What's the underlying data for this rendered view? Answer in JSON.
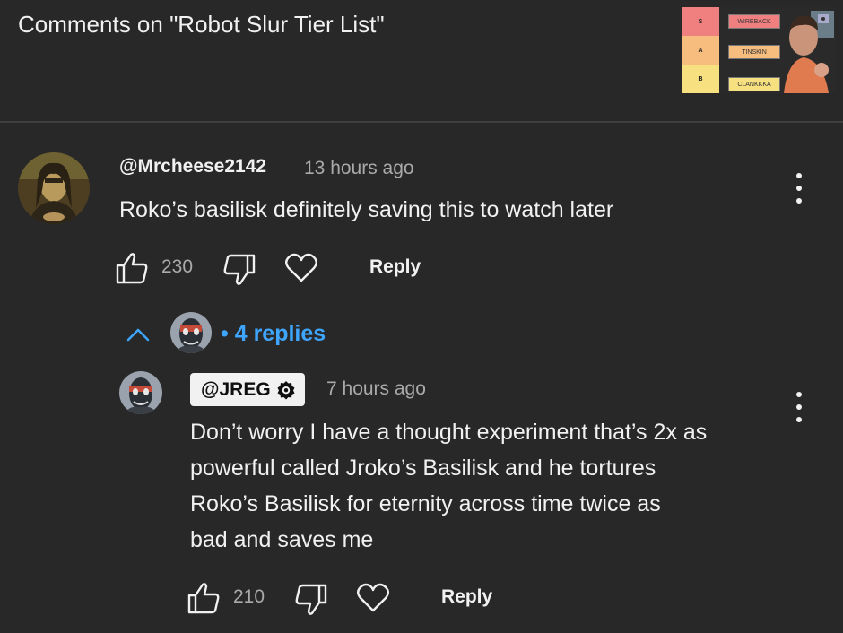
{
  "header": {
    "title": "Comments on \"Robot Slur Tier List\""
  },
  "thumbnail": {
    "tiers": [
      {
        "label": "S",
        "color": "#f08080",
        "card": "WIREBACK"
      },
      {
        "label": "A",
        "color": "#f6bd7f",
        "card": "TINSKIN"
      },
      {
        "label": "B",
        "color": "#f6e07f",
        "card": "CLANKKKA"
      }
    ]
  },
  "comment": {
    "author": "@Mrcheese2142",
    "time": "13 hours ago",
    "text": "Roko’s basilisk definitely saving this to watch later",
    "likes": "230",
    "reply_label": "Reply"
  },
  "replies_toggle": {
    "label": "4 replies",
    "bullet": "•",
    "color": "#3ea6ff"
  },
  "reply": {
    "author": "@JREG",
    "time": "7 hours ago",
    "text_lines": [
      "Don’t worry I have a thought experiment that’s 2x as",
      "powerful called Jroko’s Basilisk and he tortures",
      "Roko’s Basilisk for eternity across time twice as",
      "bad and saves me"
    ],
    "likes": "210",
    "reply_label": "Reply"
  },
  "icons": {
    "like": "thumb-up-icon",
    "dislike": "thumb-down-icon",
    "heart": "heart-icon",
    "more": "more-vertical-icon",
    "collapse": "chevron-up-icon",
    "verified": "verified-badge-icon"
  }
}
